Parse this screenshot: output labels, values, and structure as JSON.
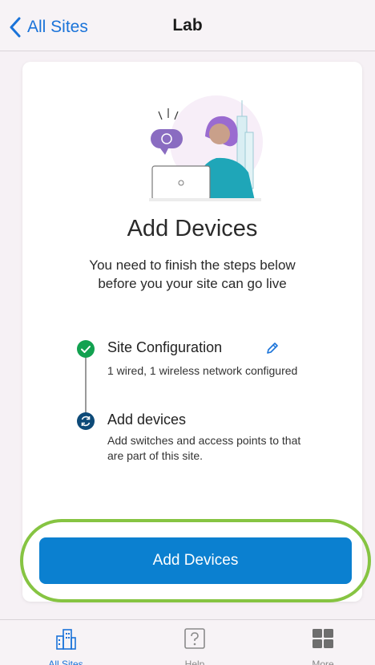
{
  "nav": {
    "back_label": "All Sites",
    "title": "Lab"
  },
  "card": {
    "title": "Add Devices",
    "description": "You need to finish the steps below before you your site can go live"
  },
  "steps": [
    {
      "title": "Site Configuration",
      "description": "1 wired, 1 wireless network configured",
      "status": "completed",
      "icon": "check-icon"
    },
    {
      "title": "Add devices",
      "description": "Add switches and access points to that are part of this site.",
      "status": "in-progress",
      "icon": "sync-icon"
    }
  ],
  "cta": {
    "label": "Add Devices"
  },
  "tabbar": {
    "tabs": [
      {
        "label": "All Sites",
        "icon": "buildings-icon",
        "active": true
      },
      {
        "label": "Help",
        "icon": "help-icon",
        "active": false
      },
      {
        "label": "More",
        "icon": "grid-icon",
        "active": false
      }
    ]
  },
  "colors": {
    "accent": "#1a73d9",
    "primary_button": "#0b80d0",
    "success": "#12a150",
    "step_current": "#0d4a78",
    "highlight_ring": "#86c442"
  }
}
